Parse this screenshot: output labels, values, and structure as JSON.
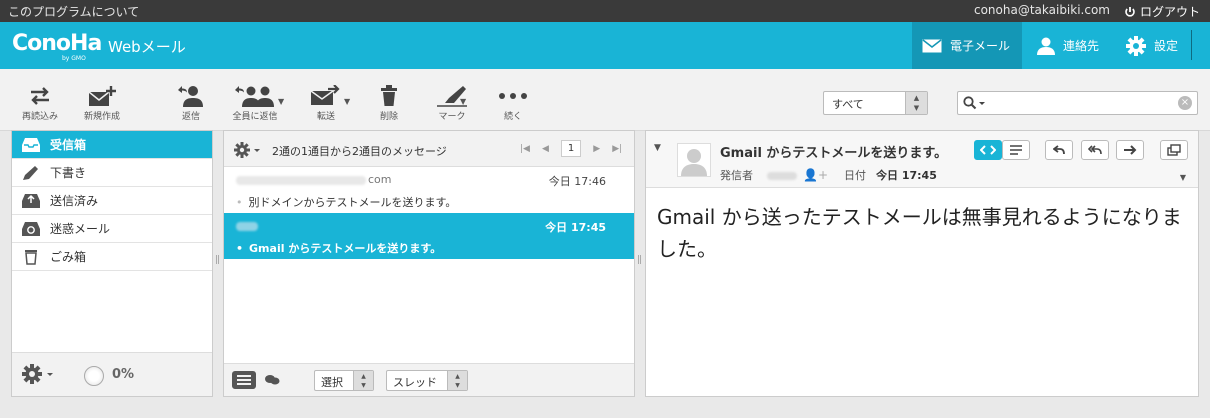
{
  "topbar": {
    "about": "このプログラムについて",
    "user": "conoha@takaibiki.com",
    "logout": "ログアウト"
  },
  "header": {
    "logo": "ConoHa",
    "logo_sub": "by GMO",
    "app_name": "Webメール",
    "nav": {
      "mail": "電子メール",
      "contacts": "連絡先",
      "settings": "設定"
    }
  },
  "toolbar": {
    "refresh": "再読込み",
    "compose": "新規作成",
    "reply": "返信",
    "reply_all": "全員に返信",
    "forward": "転送",
    "delete": "削除",
    "mark": "マーク",
    "more": "続く",
    "filter": "すべて",
    "search_placeholder": ""
  },
  "folders": [
    {
      "label": "受信箱",
      "icon": "inbox-icon",
      "active": true
    },
    {
      "label": "下書き",
      "icon": "pencil-icon"
    },
    {
      "label": "送信済み",
      "icon": "sent-icon"
    },
    {
      "label": "迷惑メール",
      "icon": "junk-icon"
    },
    {
      "label": "ごみ箱",
      "icon": "trash-icon"
    }
  ],
  "quota": "0%",
  "messagelist": {
    "count_text": "2通の1通目から2通目のメッセージ",
    "page": "1",
    "messages": [
      {
        "from_suffix": "com",
        "date": "今日 17:46",
        "subject": "別ドメインからテストメールを送ります。"
      },
      {
        "from_suffix": "",
        "date": "今日 17:45",
        "subject": "Gmail からテストメールを送ります。",
        "selected": true
      }
    ],
    "select_label": "選択",
    "thread_label": "スレッド"
  },
  "preview": {
    "subject": "Gmail からテストメールを送ります。",
    "sender_label": "発信者",
    "date_label": "日付",
    "date_value": "今日 17:45",
    "body": "Gmail から送ったテストメールは無事見れるようになりました。"
  },
  "colors": {
    "accent": "#19b4d6",
    "accent_dark": "#1497b6",
    "topbar": "#3a3a3a"
  }
}
